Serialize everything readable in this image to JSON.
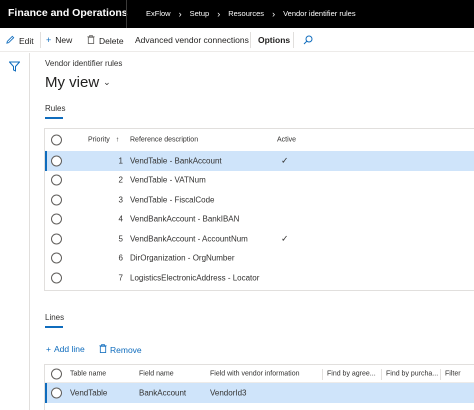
{
  "app_title": "Finance and Operations",
  "breadcrumbs": [
    "ExFlow",
    "Setup",
    "Resources",
    "Vendor identifier rules"
  ],
  "actions": {
    "edit": "Edit",
    "new": "New",
    "delete": "Delete",
    "advanced": "Advanced vendor connections",
    "options": "Options"
  },
  "page": {
    "caption": "Vendor identifier rules",
    "view": "My view"
  },
  "rules": {
    "section_label": "Rules",
    "columns": {
      "priority": "Priority",
      "priority_sort": "↑",
      "reference": "Reference description",
      "active": "Active"
    },
    "rows": [
      {
        "priority": "1",
        "reference": "VendTable - BankAccount",
        "active": true,
        "selected": true
      },
      {
        "priority": "2",
        "reference": "VendTable - VATNum",
        "active": false
      },
      {
        "priority": "3",
        "reference": "VendTable - FiscalCode",
        "active": false
      },
      {
        "priority": "4",
        "reference": "VendBankAccount - BankIBAN",
        "active": false
      },
      {
        "priority": "5",
        "reference": "VendBankAccount - AccountNum",
        "active": true
      },
      {
        "priority": "6",
        "reference": "DirOrganization - OrgNumber",
        "active": false
      },
      {
        "priority": "7",
        "reference": "LogisticsElectronicAddress - Locator",
        "active": false
      }
    ],
    "checkmark": "✓"
  },
  "lines": {
    "section_label": "Lines",
    "add_line": "Add line",
    "remove": "Remove",
    "columns": {
      "table_name": "Table name",
      "field_name": "Field name",
      "vendor_field": "Field with vendor information",
      "agree": "Find by agree...",
      "purcha": "Find by purcha...",
      "filter": "Filter"
    },
    "rows": [
      {
        "table_name": "VendTable",
        "field_name": "BankAccount",
        "vendor_field": "VendorId3",
        "selected": true
      }
    ]
  },
  "colors": {
    "accent": "#0f6cbd",
    "selected_row": "#cfe4fa",
    "topbar": "#000000"
  },
  "icons": [
    "edit-icon",
    "plus-icon",
    "trash-icon",
    "search-icon",
    "filter-icon",
    "chevron-right-icon",
    "chevron-down-icon",
    "check-icon"
  ]
}
